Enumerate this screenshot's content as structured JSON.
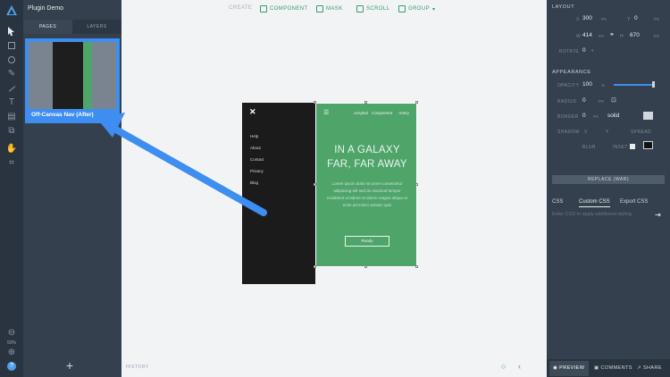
{
  "app": {
    "project_title": "Plugin Demo"
  },
  "rail": {
    "tools": [
      "logo-icon",
      "pointer-icon",
      "rectangle-icon",
      "ellipse-icon",
      "pen-icon",
      "line-icon",
      "text-icon",
      "layers-icon",
      "component-icon",
      "hand-icon",
      "crop-icon"
    ],
    "zoom_label": "50%"
  },
  "pages_panel": {
    "tabs": [
      {
        "label": "PAGES"
      },
      {
        "label": "LAYERS"
      }
    ],
    "pages": [
      {
        "name": "Off-Canvas Nav (After)"
      }
    ],
    "add_label": "+"
  },
  "toolbar": {
    "items": [
      {
        "label": "CREATE"
      },
      {
        "label": "COMPONENT"
      },
      {
        "label": "MASK"
      },
      {
        "label": "SCROLL"
      },
      {
        "label": "GROUP"
      }
    ]
  },
  "mockup": {
    "close_glyph": "✕",
    "nav_links": [
      "Help",
      "About",
      "Contact",
      "Privacy",
      "Blog"
    ],
    "top_menu": [
      "Ansykal",
      "Component",
      "Artery"
    ],
    "hero_title_line1": "IN A GALAXY",
    "hero_title_line2": "FAR, FAR AWAY",
    "hero_body": "Lorem ipsum dolor sit amet consectetur adipiscing elit sed do eiusmod tempor incididunt ut labore et dolore magna aliqua ut enim ad minim veniam quis",
    "cta_label": "Ready",
    "colors": {
      "nav_bg": "#1b1b1b",
      "screen_bg": "#4fa46a"
    }
  },
  "canvas_footer": {
    "label": "HISTORY"
  },
  "inspector": {
    "layout": {
      "title": "LAYOUT",
      "x_label": "X",
      "x_value": "300",
      "x_unit": "PX",
      "y_label": "Y",
      "y_value": "0",
      "y_unit": "PX",
      "w_label": "W",
      "w_value": "414",
      "w_unit": "PX",
      "h_label": "H",
      "h_value": "670",
      "h_unit": "PX",
      "rotate_label": "ROTATE",
      "rotate_value": "0"
    },
    "appearance": {
      "title": "APPEARANCE",
      "opacity_label": "OPACITY",
      "opacity_value": "100",
      "opacity_unit": "%",
      "opacity_fraction": 1.0,
      "radius_label": "RADIUS",
      "radius_value": "0",
      "radius_unit": "PX",
      "border_label": "BORDER",
      "border_value": "0",
      "border_unit": "PX",
      "border_style": "solid",
      "shadow_label": "SHADOW",
      "shadow_x": "X",
      "shadow_y": "Y",
      "shadow_spread": "SPREAD",
      "blur_label": "BLUR",
      "inset_label": "INSET",
      "shadow_color": "#111111"
    },
    "replace_label": "REPLACE (WAR)",
    "css_tabs": [
      {
        "label": "CSS"
      },
      {
        "label": "Custom CSS"
      },
      {
        "label": "Export CSS"
      }
    ],
    "css_placeholder": "Enter CSS to apply additional styling",
    "bottom_bar": [
      {
        "label": "PREVIEW"
      },
      {
        "label": "COMMENTS"
      },
      {
        "label": "SHARE"
      }
    ]
  },
  "colors": {
    "accent": "#3d8ef0",
    "toolbar_green": "#3a9c6e",
    "panel_bg": "#34404d"
  }
}
